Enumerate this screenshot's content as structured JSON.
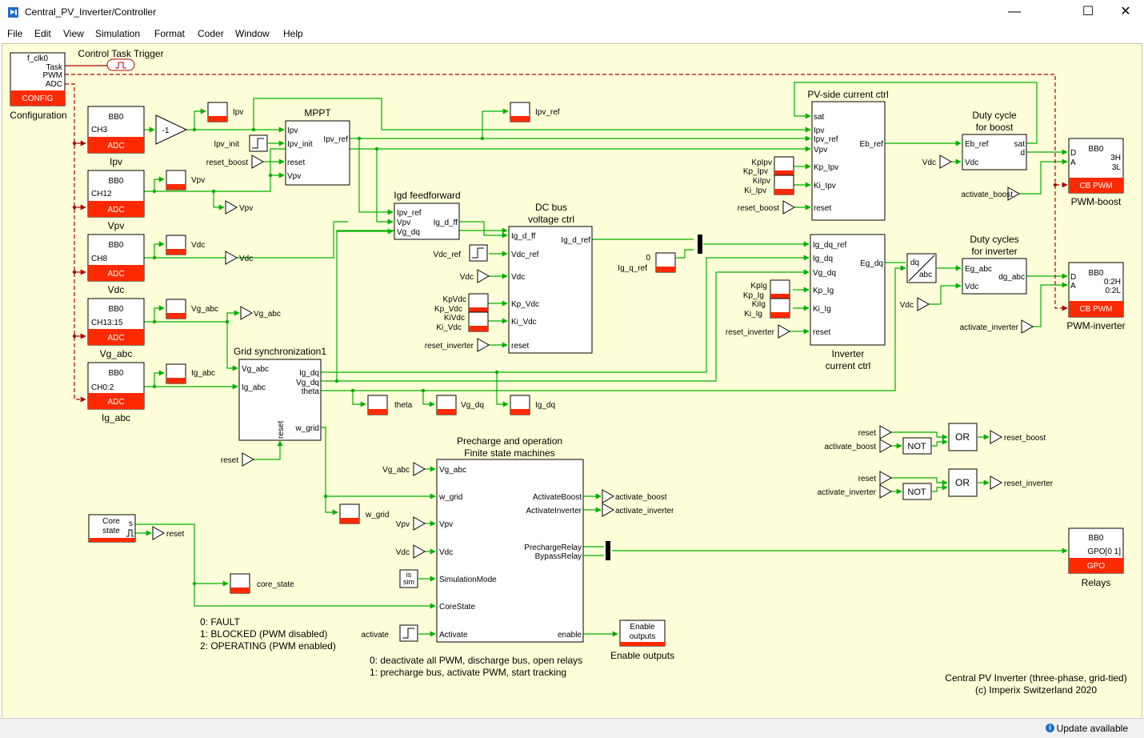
{
  "window": {
    "title": "Central_PV_Inverter/Controller",
    "minimize": "—",
    "maximize": "☐",
    "close": "✕"
  },
  "menu": [
    "File",
    "Edit",
    "View",
    "Simulation",
    "Format",
    "Coder",
    "Window",
    "Help"
  ],
  "status": {
    "text": "Update available",
    "icon": "info-icon"
  },
  "colors": {
    "canvas": "#fefed8",
    "wire": "#00b000",
    "block_red": "#ff2a00",
    "trigger": "#b00000"
  },
  "labels": {
    "f_clk0": "f_clk0",
    "task": "Task",
    "pwm": "PWM",
    "adc": "ADC",
    "config": "CONFIG",
    "configuration": "Configuration",
    "control_task_trigger": "Control Task Trigger",
    "bb0": "BB0",
    "adc_tag": "ADC",
    "ch3": "CH3",
    "ch12": "CH12",
    "ch8": "CH8",
    "ch13_15": "CH13:15",
    "ch0_2": "CH0:2",
    "ipv": "Ipv",
    "vpv": "Vpv",
    "vdc": "Vdc",
    "vg_abc": "Vg_abc",
    "ig_abc": "Ig_abc",
    "gain": "-1",
    "mppt": "MPPT",
    "ipv_init": "Ipv_init",
    "reset_boost": "reset_boost",
    "reset": "reset",
    "ipv_ref": "Ipv_ref",
    "ipv_init_port": "Ipv_init",
    "ipv_ref_port": "Ipv_ref",
    "pv_side_ctrl": "PV-side current ctrl",
    "sat": "sat",
    "eb_ref": "Eb_ref",
    "kp_ipv": "Kp_Ipv",
    "ki_ipv": "Ki_Ipv",
    "kpipv": "KpIpv",
    "kiipv": "KiIpv",
    "duty_boost_1": "Duty cycle",
    "duty_boost_2": "for boost",
    "d": "d",
    "cb_pwm": "CB PWM",
    "d_port": "D",
    "a_port": "A",
    "threeh": "3H",
    "threel": "3L",
    "pwm_boost": "PWM-boost",
    "activate_boost": "activate_boost",
    "igd_ff_title": "Igd feedforward",
    "vg_dq": "Vg_dq",
    "ig_d_ff": "Ig_d_ff",
    "dc_bus_1": "DC bus",
    "dc_bus_2": "voltage ctrl",
    "vdc_ref": "Vdc_ref",
    "kp_vdc": "Kp_Vdc",
    "ki_vdc": "Ki_Vdc",
    "kpvdc": "KpVdc",
    "kivdc": "KiVdc",
    "reset_inverter": "reset_inverter",
    "ig_d_ref": "Ig_d_ref",
    "zero": "0",
    "ig_q_ref": "Ig_q_ref",
    "ig_dq_ref": "Ig_dq_ref",
    "ig_dq": "Ig_dq",
    "eg_dq": "Eg_dq",
    "kp_ig": "Kp_Ig",
    "ki_ig": "Ki_Ig",
    "kpig": "KpIg",
    "kiig": "KiIg",
    "inv_ctrl_1": "Inverter",
    "inv_ctrl_2": "current ctrl",
    "dq": "dq",
    "abc": "abc",
    "duty_inv_1": "Duty cycles",
    "duty_inv_2": "for inverter",
    "eg_abc": "Eg_abc",
    "dg_abc": "dg_abc",
    "pwm_inverter": "PWM-inverter",
    "activate_inverter": "activate_inverter",
    "r02h": "0:2H",
    "r02l": "0:2L",
    "grid_sync": "Grid synchronization1",
    "theta": "theta",
    "w_grid": "w_grid",
    "or": "OR",
    "not": "NOT",
    "fsm_1": "Precharge and operation",
    "fsm_2": "Finite state machines",
    "activate_boost_port": "ActivateBoost",
    "activate_inverter_port": "ActivateInverter",
    "precharge_relay": "PrechargeRelay",
    "bypass_relay": "BypassRelay",
    "simulation_mode": "SimulationMode",
    "core_state_port": "CoreState",
    "activate_port": "Activate",
    "enable": "enable",
    "activate": "activate",
    "is": "is",
    "sim": "sim",
    "enable_outputs_1": "Enable",
    "enable_outputs_2": "outputs",
    "enable_outputs": "Enable outputs",
    "gpo_range": "GPO[0 1]",
    "gpo": "GPO",
    "relays": "Relays",
    "core": "Core",
    "state": "state",
    "s": "s",
    "core_state": "core_state"
  },
  "notes": {
    "core_states": [
      "0: FAULT",
      "1: BLOCKED (PWM disabled)",
      "2: OPERATING (PWM enabled)"
    ],
    "activate": [
      "0: deactivate all PWM, discharge bus, open relays",
      "1: precharge bus, activate PWM, start tracking"
    ],
    "footer": [
      "Central PV Inverter (three-phase, grid-tied)",
      "(c) Imperix Switzerland 2020"
    ]
  }
}
